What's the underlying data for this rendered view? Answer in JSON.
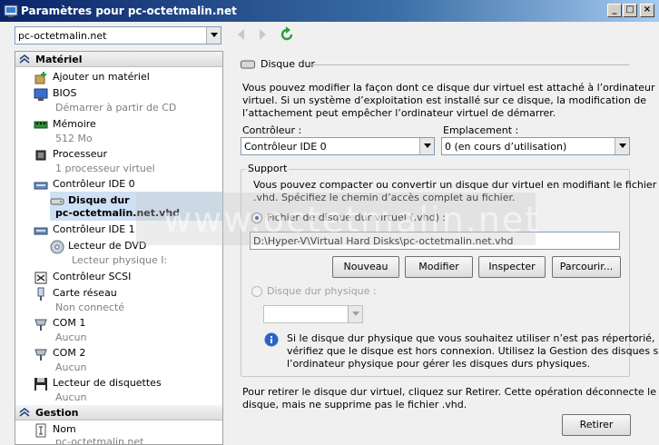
{
  "window": {
    "title": "Paramètres pour pc-octetmalin.net",
    "min_glyph": "_",
    "max_glyph": "□",
    "close_glyph": "×"
  },
  "toolbar": {
    "vm_selector_value": "pc-octetmalin.net"
  },
  "sidebar": {
    "hardware_header": "Matériel",
    "management_header": "Gestion",
    "items": [
      {
        "name": "Ajouter un matériel",
        "sub": ""
      },
      {
        "name": "BIOS",
        "sub": "Démarrer à partir de CD"
      },
      {
        "name": "Mémoire",
        "sub": "512 Mo"
      },
      {
        "name": "Processeur",
        "sub": "1 processeur virtuel"
      },
      {
        "name": "Contrôleur IDE 0",
        "sub": ""
      },
      {
        "name": "Disque dur",
        "sub": "pc-octetmalin.net.vhd"
      },
      {
        "name": "Contrôleur IDE 1",
        "sub": ""
      },
      {
        "name": "Lecteur de DVD",
        "sub": "Lecteur physique I:"
      },
      {
        "name": "Contrôleur SCSI",
        "sub": ""
      },
      {
        "name": "Carte réseau",
        "sub": "Non connecté"
      },
      {
        "name": "COM 1",
        "sub": "Aucun"
      },
      {
        "name": "COM 2",
        "sub": "Aucun"
      },
      {
        "name": "Lecteur de disquettes",
        "sub": "Aucun"
      },
      {
        "name": "Nom",
        "sub": "pc-octetmalin.net"
      }
    ]
  },
  "panel": {
    "header": "Disque dur",
    "intro_line1": "Vous pouvez modifier la façon dont ce disque dur virtuel est attaché à l’ordinateur",
    "intro_line2": "virtuel. Si un système d’exploitation est installé sur ce disque, la modification de",
    "intro_line3": "l’attachement peut empêcher l’ordinateur virtuel de démarrer.",
    "controller_label": "Contrôleur :",
    "controller_value": "Contrôleur IDE 0",
    "location_label": "Emplacement :",
    "location_value": "0 (en cours d’utilisation)",
    "support_title": "Support",
    "support_line1": "Vous pouvez compacter ou convertir un disque dur virtuel en modifiant le fichier",
    "support_line2": ".vhd. Spécifiez le chemin d’accès complet au fichier.",
    "vhd_radio_label": "Fichier de disque dur virtuel (.vhd) :",
    "vhd_path": "D:\\Hyper-V\\Virtual Hard Disks\\pc-octetmalin.net.vhd",
    "btn_new": "Nouveau",
    "btn_edit": "Modifier",
    "btn_inspect": "Inspecter",
    "btn_browse": "Parcourir...",
    "physical_radio_label": "Disque dur physique :",
    "info_line1": "Si le disque dur physique que vous souhaitez utiliser n’est pas répertorié,",
    "info_line2": "vérifiez que le disque est hors connexion. Utilisez la Gestion des disques sur",
    "info_line3": "l’ordinateur physique pour gérer les disques durs physiques.",
    "remove_line1": "Pour retirer le disque dur virtuel, cliquez sur Retirer. Cette opération déconnecte le",
    "remove_line2": "disque, mais ne supprime pas le fichier .vhd.",
    "btn_remove": "Retirer"
  },
  "watermark": "www.octetmalin.net"
}
